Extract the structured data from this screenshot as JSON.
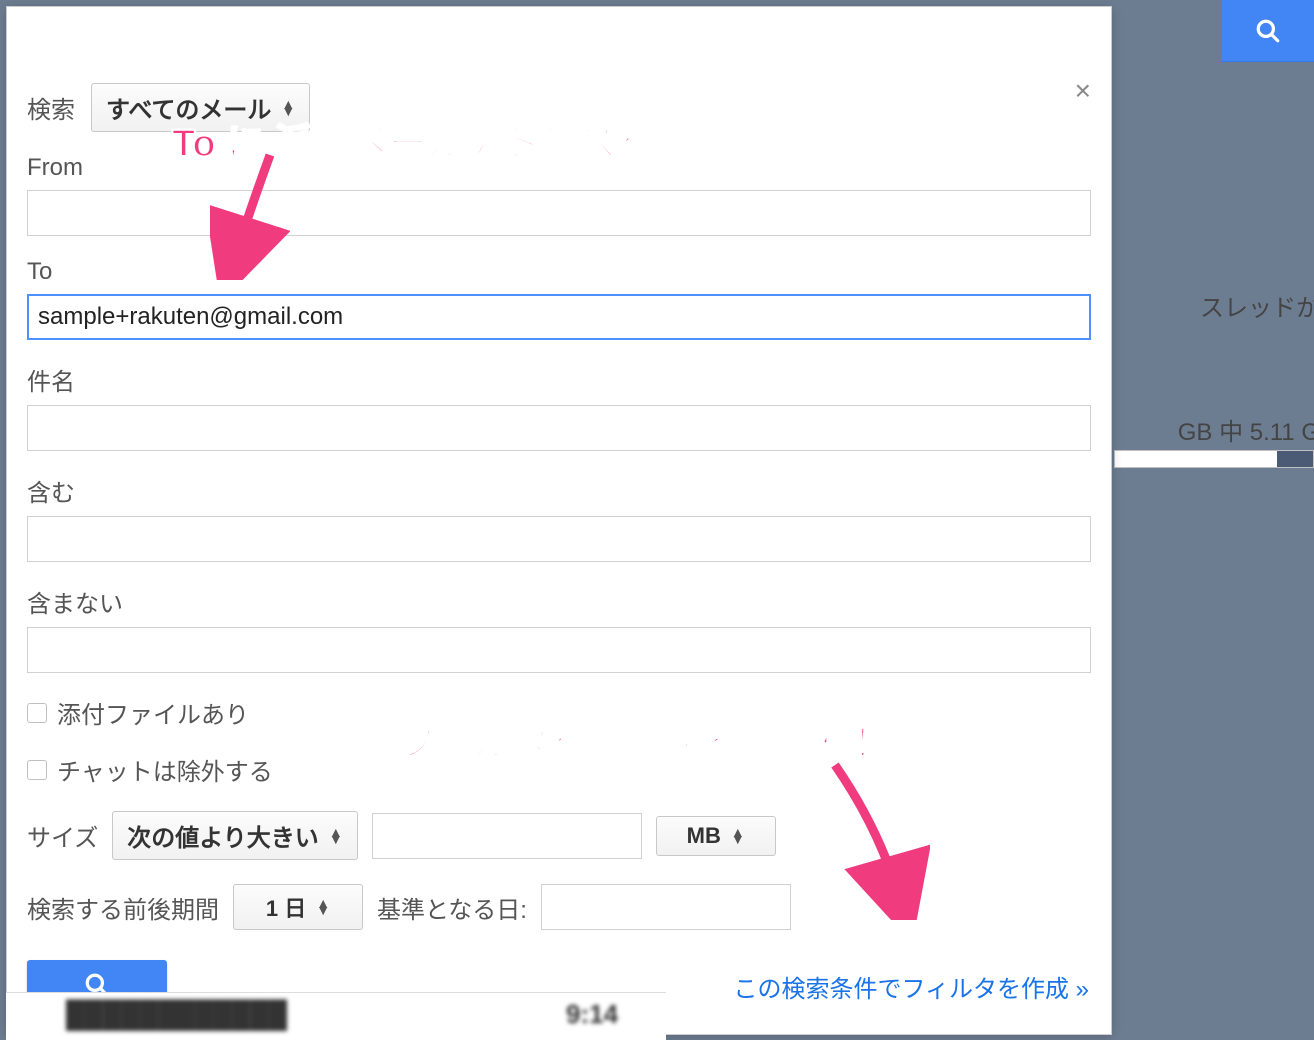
{
  "form": {
    "search_label": "検索",
    "search_scope_select": "すべてのメール",
    "from_label": "From",
    "from_value": "",
    "to_label": "To",
    "to_value": "sample+rakuten@gmail.com",
    "subject_label": "件名",
    "subject_value": "",
    "has_words_label": "含む",
    "has_words_value": "",
    "not_has_words_label": "含まない",
    "not_has_words_value": "",
    "has_attachment_label": "添付ファイルあり",
    "exclude_chat_label": "チャットは除外する",
    "size_label": "サイズ",
    "size_compare_select": "次の値より大きい",
    "size_value": "",
    "size_unit_select": "MB",
    "period_label": "検索する前後期間",
    "period_select": "1 日",
    "base_date_label": "基準となる日:",
    "base_date_value": "",
    "create_filter_link": "この検索条件でフィルタを作成 »"
  },
  "background": {
    "thread_text": "スレッドか",
    "storage_text": "GB 中 5.11 G",
    "bottom_time": "9:14"
  },
  "annotations": {
    "top": "To に 派生メールアドレスを登録",
    "bottom": "フィルタを作成すると便利！"
  }
}
